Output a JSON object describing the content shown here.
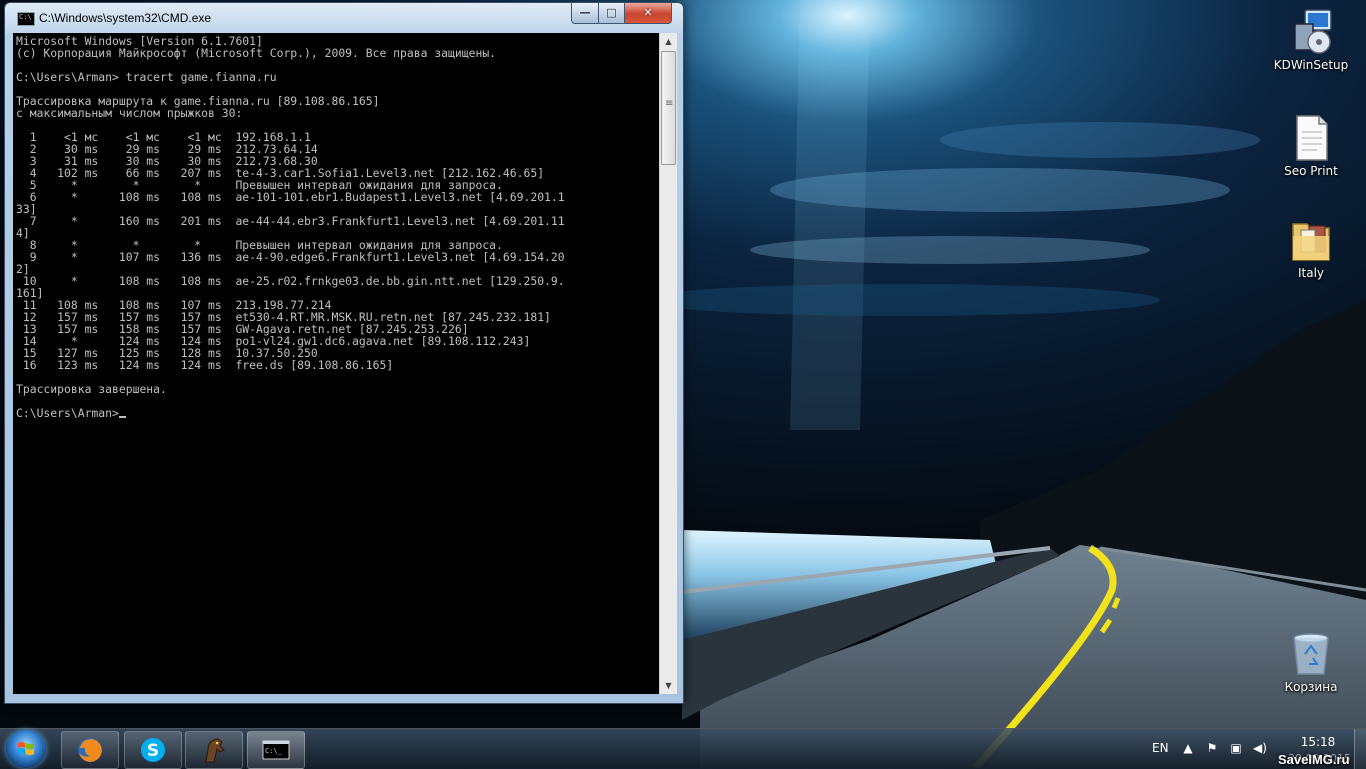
{
  "window": {
    "title": "C:\\Windows\\system32\\CMD.exe",
    "min_symbol": "—",
    "max_symbol": "□",
    "close_symbol": "✕"
  },
  "console": {
    "lines": [
      "Microsoft Windows [Version 6.1.7601]",
      "(c) Корпорация Майкрософт (Microsoft Corp.), 2009. Все права защищены.",
      "",
      "C:\\Users\\Arman> tracert game.fianna.ru",
      "",
      "Трассировка маршрута к game.fianna.ru [89.108.86.165]",
      "с максимальным числом прыжков 30:",
      "",
      "  1    <1 мс    <1 мс    <1 мс  192.168.1.1",
      "  2    30 ms    29 ms    29 ms  212.73.64.14",
      "  3    31 ms    30 ms    30 ms  212.73.68.30",
      "  4   102 ms    66 ms   207 ms  te-4-3.car1.Sofia1.Level3.net [212.162.46.65]",
      "  5     *        *        *     Превышен интервал ожидания для запроса.",
      "  6     *      108 ms   108 ms  ae-101-101.ebr1.Budapest1.Level3.net [4.69.201.1",
      "33]",
      "  7     *      160 ms   201 ms  ae-44-44.ebr3.Frankfurt1.Level3.net [4.69.201.11",
      "4]",
      "  8     *        *        *     Превышен интервал ожидания для запроса.",
      "  9     *      107 ms   136 ms  ae-4-90.edge6.Frankfurt1.Level3.net [4.69.154.20",
      "2]",
      " 10     *      108 ms   108 ms  ae-25.r02.frnkge03.de.bb.gin.ntt.net [129.250.9.",
      "161]",
      " 11   108 ms   108 ms   107 ms  213.198.77.214",
      " 12   157 ms   157 ms   157 ms  et530-4.RT.MR.MSK.RU.retn.net [87.245.232.181]",
      " 13   157 ms   158 ms   157 ms  GW-Agava.retn.net [87.245.253.226]",
      " 14     *      124 ms   124 ms  po1-vl24.gw1.dc6.agava.net [89.108.112.243]",
      " 15   127 ms   125 ms   128 ms  10.37.50.250",
      " 16   123 ms   124 ms   124 ms  free.ds [89.108.86.165]",
      "",
      "Трассировка завершена.",
      "",
      "C:\\Users\\Arman>"
    ]
  },
  "desktop_icons": [
    {
      "label": "KDWinSetup",
      "icon": "installer-icon"
    },
    {
      "label": "Seo Print",
      "icon": "document-icon"
    },
    {
      "label": "Italy",
      "icon": "folder-icon"
    },
    {
      "label": "Корзина",
      "icon": "recycle-bin-icon"
    }
  ],
  "taskbar": {
    "apps": [
      {
        "name": "Firefox",
        "icon": "firefox-icon"
      },
      {
        "name": "Skype",
        "icon": "skype-icon"
      },
      {
        "name": "Game",
        "icon": "horse-game-icon"
      },
      {
        "name": "CMD",
        "icon": "cmd-icon"
      }
    ],
    "language": "EN",
    "clock_time": "15:18",
    "clock_date": "30.09.2015"
  },
  "watermark": "SaveIMG.ru",
  "colors": {
    "console_bg": "#000000",
    "console_fg": "#c0c0c0",
    "close_button": "#c8452f"
  }
}
